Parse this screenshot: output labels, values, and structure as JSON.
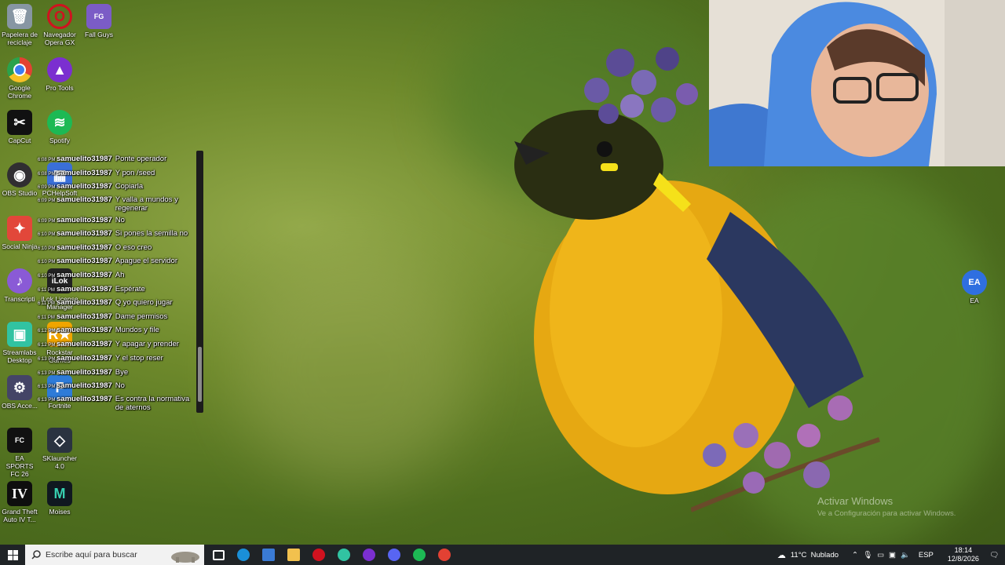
{
  "desktop_icons": [
    {
      "label": "Papelera de reciclaje",
      "icon": "recycle-bin-icon",
      "color": "#7a8a9a"
    },
    {
      "label": "Navegador Opera GX",
      "icon": "opera-gx-icon",
      "color": "#d0121f"
    },
    {
      "label": "Fall Guys",
      "icon": "fall-guys-icon",
      "color": "#7b5cc6"
    },
    {
      "label": "Google Chrome",
      "icon": "chrome-icon",
      "color": "#e34133"
    },
    {
      "label": "Pro Tools",
      "icon": "pro-tools-icon",
      "color": "#7b2fd0"
    },
    {
      "label": "CapCut",
      "icon": "capcut-icon",
      "color": "#111111"
    },
    {
      "label": "Spotify",
      "icon": "spotify-icon",
      "color": "#1db954"
    },
    {
      "label": "OBS Studio",
      "icon": "obs-icon",
      "color": "#302e31"
    },
    {
      "label": "PCHelpSoft",
      "icon": "pchelpsoft-icon",
      "color": "#3a6fd8"
    },
    {
      "label": "Social Ninja",
      "icon": "social-ninja-icon",
      "color": "#e2473a"
    },
    {
      "label": "Transcripti",
      "icon": "transcription-icon",
      "color": "#8a5ad6"
    },
    {
      "label": "iLok License Manager",
      "icon": "ilok-icon",
      "color": "#222222"
    },
    {
      "label": "Streamlabs Desktop",
      "icon": "streamlabs-icon",
      "color": "#31c3a2"
    },
    {
      "label": "Rockstar Games",
      "icon": "rockstar-icon",
      "color": "#f0a500"
    },
    {
      "label": "OBS Acce...",
      "icon": "obs-accessory-icon",
      "color": "#444466"
    },
    {
      "label": "Fortnite",
      "icon": "fortnite-icon",
      "color": "#2e7bd8"
    },
    {
      "label": "EA SPORTS FC 26",
      "icon": "ea-fc-icon",
      "color": "#111111"
    },
    {
      "label": "SKlauncher 4.0",
      "icon": "sklauncher-icon",
      "color": "#2a3340"
    },
    {
      "label": "Grand Theft Auto IV T...",
      "icon": "gta-iv-icon",
      "color": "#0e0e0e"
    },
    {
      "label": "Moises",
      "icon": "moises-icon",
      "color": "#101820"
    },
    {
      "label": "EA",
      "icon": "ea-icon",
      "color": "#2f6fe0"
    }
  ],
  "chat": {
    "messages": [
      {
        "time": "6:08 PM",
        "user": "samuelito31987",
        "text": "Ponte operador"
      },
      {
        "time": "6:08 PM",
        "user": "samuelito31987",
        "text": "Y pon /seed"
      },
      {
        "time": "6:09 PM",
        "user": "samuelito31987",
        "text": "Copiarla"
      },
      {
        "time": "6:09 PM",
        "user": "samuelito31987",
        "text": "Y valla a mundos y regenerar"
      },
      {
        "time": "6:09 PM",
        "user": "samuelito31987",
        "text": "No"
      },
      {
        "time": "6:10 PM",
        "user": "samuelito31987",
        "text": "Si pones la semilla no"
      },
      {
        "time": "6:10 PM",
        "user": "samuelito31987",
        "text": "O eso creo"
      },
      {
        "time": "6:10 PM",
        "user": "samuelito31987",
        "text": "Apague el servidor"
      },
      {
        "time": "6:10 PM",
        "user": "samuelito31987",
        "text": "Ah"
      },
      {
        "time": "6:11 PM",
        "user": "samuelito31987",
        "text": "Espérate"
      },
      {
        "time": "6:11 PM",
        "user": "samuelito31987",
        "text": "Q yo quiero jugar"
      },
      {
        "time": "6:11 PM",
        "user": "samuelito31987",
        "text": "Dame permisos"
      },
      {
        "time": "6:12 PM",
        "user": "samuelito31987",
        "text": "Mundos y file"
      },
      {
        "time": "6:12 PM",
        "user": "samuelito31987",
        "text": "Y apagar y prender"
      },
      {
        "time": "6:13 PM",
        "user": "samuelito31987",
        "text": "Y el stop reser"
      },
      {
        "time": "6:13 PM",
        "user": "samuelito31987",
        "text": "Bye"
      },
      {
        "time": "6:13 PM",
        "user": "samuelito31987",
        "text": "No"
      },
      {
        "time": "6:13 PM",
        "user": "samuelito31987",
        "text": "Es contra la normativa de aternos"
      }
    ]
  },
  "watermark": {
    "line1": "Activar Windows",
    "line2": "Ve a Configuración para activar Windows."
  },
  "taskbar": {
    "search_placeholder": "Escribe aquí para buscar",
    "apps": [
      {
        "icon": "task-view-icon",
        "color": "#ffffff"
      },
      {
        "icon": "edge-icon",
        "color": "#1a8fd8"
      },
      {
        "icon": "store-icon",
        "color": "#3a7bd5"
      },
      {
        "icon": "file-explorer-icon",
        "color": "#f2c14e"
      },
      {
        "icon": "opera-gx-icon",
        "color": "#d0121f"
      },
      {
        "icon": "streamlabs-icon",
        "color": "#31c3a2"
      },
      {
        "icon": "pro-tools-icon",
        "color": "#7b2fd0"
      },
      {
        "icon": "discord-icon",
        "color": "#5865f2"
      },
      {
        "icon": "spotify-icon",
        "color": "#1db954"
      },
      {
        "icon": "chrome-icon",
        "color": "#e34133"
      }
    ],
    "weather": "11°C  Nublado",
    "language": "ESP",
    "time": "18:14",
    "date": "12/8/2026"
  }
}
